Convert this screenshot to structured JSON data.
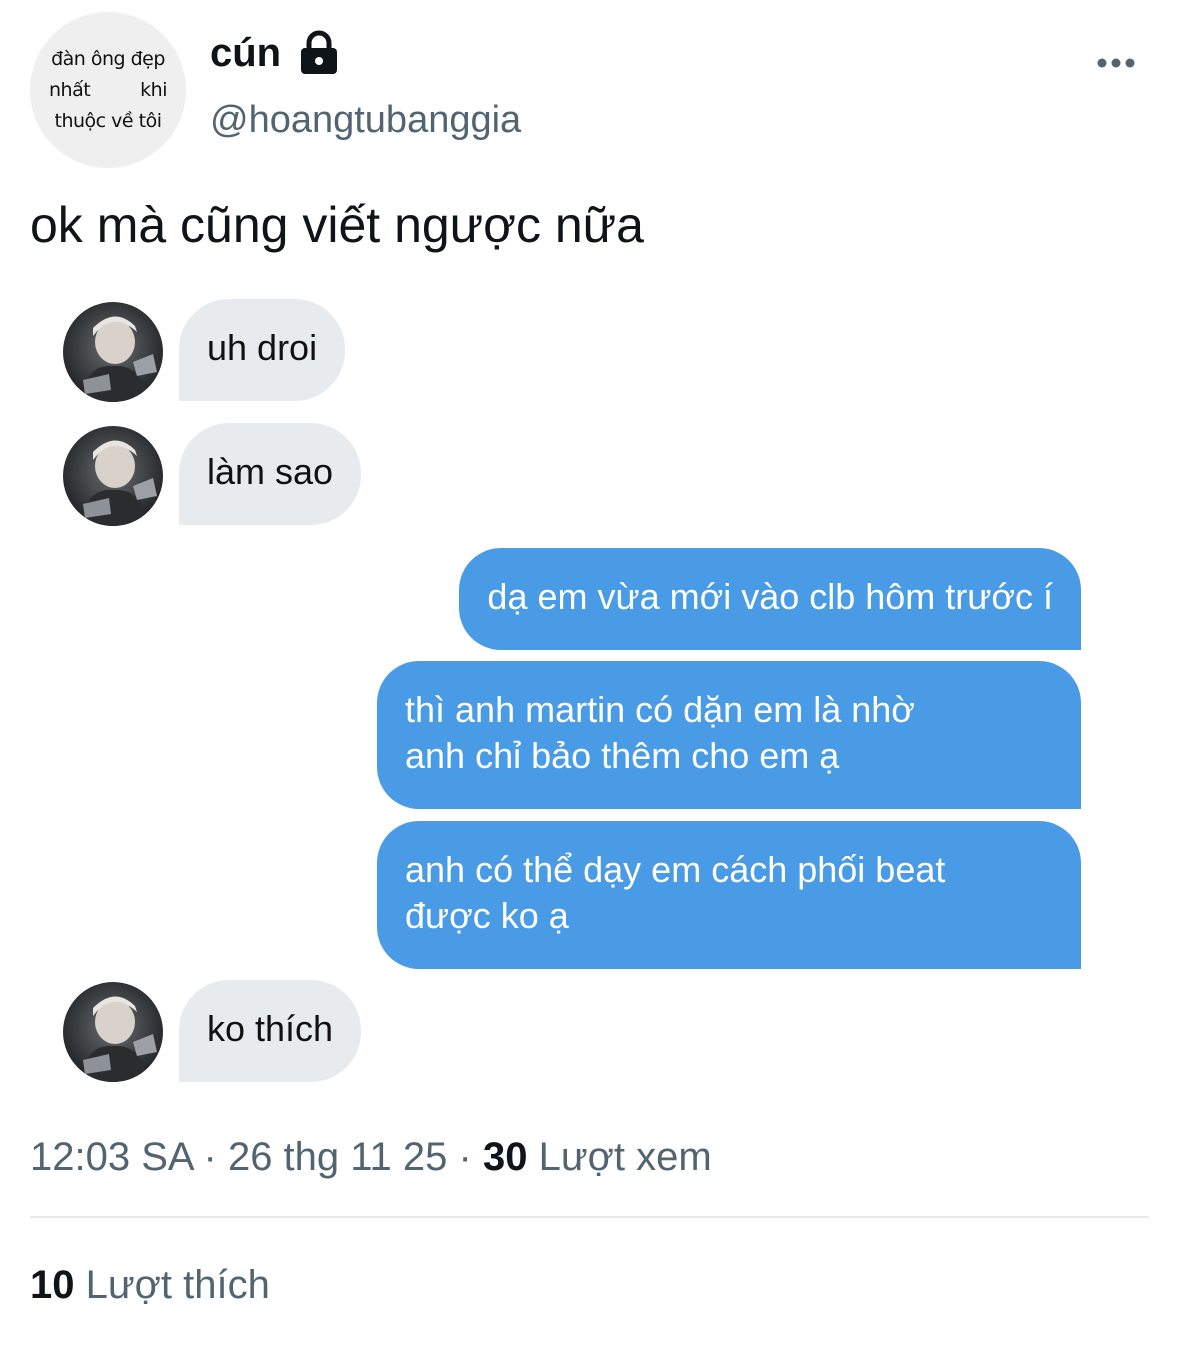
{
  "author": {
    "avatar_text_line1": "đàn ông đẹp",
    "avatar_text_line2a": "nhất",
    "avatar_text_line2b": "khi",
    "avatar_text_line3": "thuộc về tôi",
    "display_name": "cún",
    "handle": "@hoangtubanggia",
    "lock_icon": "lock-icon",
    "more_icon": "more-icon"
  },
  "tweet": {
    "text": "ok mà cũng viết ngược nữa"
  },
  "chat": {
    "messages": [
      {
        "side": "incoming",
        "text": "uh droi"
      },
      {
        "side": "incoming",
        "text": "làm sao"
      },
      {
        "side": "outgoing",
        "text": "dạ em vừa mới vào clb hôm trước í"
      },
      {
        "side": "outgoing",
        "line1": "thì anh martin có dặn em là nhờ",
        "line2": "anh chỉ bảo thêm cho em ạ"
      },
      {
        "side": "outgoing",
        "line1": "anh có thể dạy em cách phối beat",
        "line2": "được ko ạ"
      },
      {
        "side": "incoming",
        "text": "ko thích"
      }
    ],
    "colors": {
      "incoming_bubble": "#e8ebee",
      "outgoing_bubble": "#4a9be6"
    }
  },
  "meta": {
    "time": "12:03 SA",
    "separator": "·",
    "date": "26 thg 11 25",
    "views_count": "30",
    "views_label": "Lượt xem"
  },
  "stats": {
    "likes_count": "10",
    "likes_label": "Lượt thích"
  }
}
